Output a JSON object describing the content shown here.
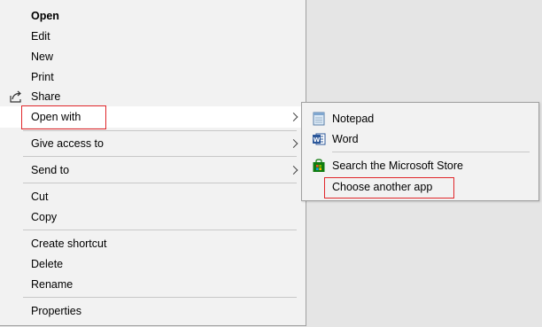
{
  "main_menu": {
    "open": "Open",
    "edit": "Edit",
    "new": "New",
    "print": "Print",
    "share": "Share",
    "open_with": "Open with",
    "give_access_to": "Give access to",
    "send_to": "Send to",
    "cut": "Cut",
    "copy": "Copy",
    "create_shortcut": "Create shortcut",
    "delete": "Delete",
    "rename": "Rename",
    "properties": "Properties"
  },
  "sub_menu": {
    "notepad": "Notepad",
    "word": "Word",
    "search_store": "Search the Microsoft Store",
    "choose_another_app": "Choose another app"
  },
  "icons": {
    "share": "share-icon",
    "notepad": "notepad-icon",
    "word": "word-icon",
    "store": "microsoft-store-icon"
  },
  "colors": {
    "menu_bg": "#f2f2f2",
    "highlight_bg": "#ffffff",
    "annotation_red": "#e0262a",
    "word_blue": "#2b579a",
    "store_green": "#107c10"
  }
}
